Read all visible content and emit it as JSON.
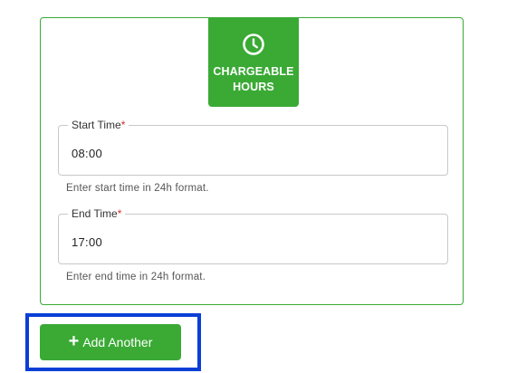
{
  "badge": {
    "icon": "clock-icon",
    "label": "CHARGEABLE\nHOURS",
    "color": "#3aaa35"
  },
  "start_time": {
    "label": "Start Time",
    "required_marker": "*",
    "value": "08:00",
    "hint": "Enter start time in 24h format."
  },
  "end_time": {
    "label": "End Time",
    "required_marker": "*",
    "value": "17:00",
    "hint": "Enter end time in 24h format."
  },
  "add_button": {
    "icon": "plus-icon",
    "plus_glyph": "+",
    "label": "Add Another",
    "color": "#3aaa35"
  },
  "highlight_color": "#0a3fd6"
}
